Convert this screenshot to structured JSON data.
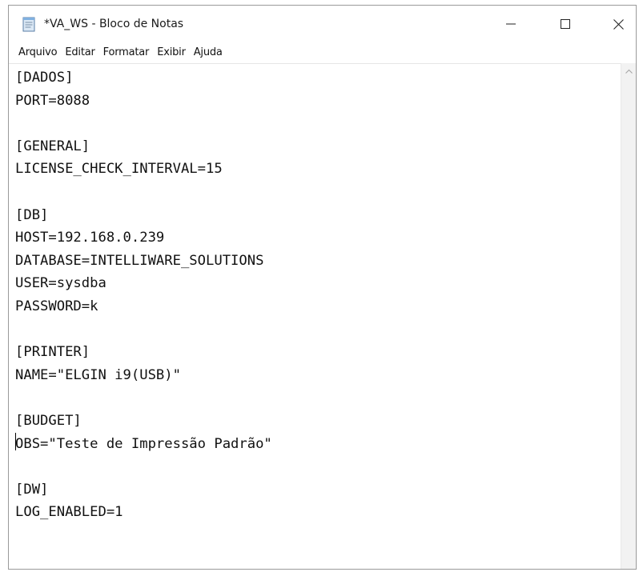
{
  "window": {
    "title": "*VA_WS - Bloco de Notas",
    "minimize_glyph": "—",
    "maximize_glyph": "☐",
    "close_glyph": "✕",
    "app_icon": "notepad-icon"
  },
  "menu": {
    "items": [
      "Arquivo",
      "Editar",
      "Formatar",
      "Exibir",
      "Ajuda"
    ]
  },
  "editor": {
    "content": "[DADOS]\nPORT=8088\n\n[GENERAL]\nLICENSE_CHECK_INTERVAL=15\n\n[DB]\nHOST=192.168.0.239\nDATABASE=INTELLIWARE_SOLUTIONS\nUSER=sysdba\nPASSWORD=k\n\n[PRINTER]\nNAME=\"ELGIN i9(USB)\"\n\n[BUDGET]\nOBS=\"Teste de Impressão Padrão\"\n\n[DW]\nLOG_ENABLED=1"
  },
  "scrollbar": {
    "up_arrow": "scroll-up-arrow-icon"
  }
}
